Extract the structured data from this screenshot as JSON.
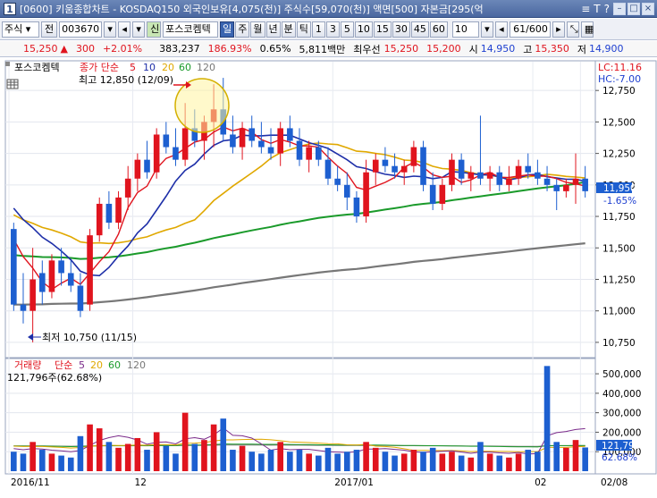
{
  "window": {
    "number": "1",
    "title": "[0600] 키움종합차트 - KOSDAQ150 외국인보유[4,075(천)] 주식수[59,070(천)] 액면[500] 자본금[295(억"
  },
  "titlebar_glyphs": [
    "≡",
    "T",
    "?"
  ],
  "toolbar": {
    "type_select": "주식",
    "prev_label": "전",
    "code": "003670",
    "stock_name": "포스코켐텍",
    "periods": [
      "일",
      "주",
      "월",
      "년",
      "분",
      "틱",
      "1",
      "3",
      "5",
      "10",
      "15",
      "30",
      "45",
      "60"
    ],
    "active_period": "일",
    "interval_value": "10",
    "count": "61/600"
  },
  "quote": {
    "price": "15,250",
    "change": "300",
    "change_rate": "+2.01%",
    "volume": "383,237",
    "volume_ratio": "186.93%",
    "turnover": "0.65%",
    "amount": "5,811백만",
    "best_label": "최우선",
    "ask": "15,250",
    "bid": "15,200",
    "open_label": "시",
    "open": "14,950",
    "high_label": "고",
    "high": "15,350",
    "low_label": "저",
    "low": "14,900"
  },
  "price_panel": {
    "stock_label": "포스코켐텍",
    "ma_title": "종가 단순",
    "ma_periods": [
      "5",
      "10",
      "20",
      "60",
      "120"
    ],
    "high_text": "최고 12,850 (12/09)",
    "low_text": "최저 10,750 (11/15)",
    "lc_label": "LC:11.16",
    "hc_label": "HC:-7.00",
    "current_price_tag": "11,950",
    "current_change_tag": "-1.65%",
    "y_ticks": [
      "12,750",
      "12,500",
      "12,250",
      "12,000",
      "11,750",
      "11,500",
      "11,250",
      "11,000",
      "10,750"
    ]
  },
  "volume_panel": {
    "title": "거래량",
    "ma_title": "단순",
    "ma_periods": [
      "5",
      "20",
      "60",
      "120"
    ],
    "value_text": "121,796주(62.68%)",
    "y_ticks": [
      "500,000",
      "400,000",
      "300,000",
      "200,000",
      "100,000"
    ],
    "current_tag": "121,796",
    "pct_tag": "62.68%"
  },
  "x_ticks": [
    "2016/11",
    "12",
    "2017/01",
    "02",
    "02/08"
  ],
  "colors": {
    "up": "#e0141e",
    "down": "#1d5fd0",
    "ma5": "#e0141e",
    "ma10": "#1e2fa8",
    "ma20": "#e0a800",
    "ma60": "#1a9a2a",
    "ma120": "#777777"
  },
  "chart_data": {
    "type": "candlestick",
    "series": [
      {
        "name": "5",
        "values": []
      },
      {
        "name": "10",
        "values": []
      },
      {
        "name": "20",
        "values": []
      },
      {
        "name": "60",
        "values": []
      },
      {
        "name": "120",
        "values": []
      }
    ],
    "candles": [
      {
        "o": 11650,
        "h": 11700,
        "l": 11000,
        "c": 11050,
        "v": 100000
      },
      {
        "o": 11050,
        "h": 11300,
        "l": 10900,
        "c": 11000,
        "v": 90000
      },
      {
        "o": 11000,
        "h": 11500,
        "l": 10750,
        "c": 11250,
        "v": 150000
      },
      {
        "o": 11300,
        "h": 11400,
        "l": 11050,
        "c": 11150,
        "v": 110000
      },
      {
        "o": 11150,
        "h": 11450,
        "l": 11100,
        "c": 11400,
        "v": 90000
      },
      {
        "o": 11400,
        "h": 11500,
        "l": 11200,
        "c": 11300,
        "v": 80000
      },
      {
        "o": 11300,
        "h": 11400,
        "l": 11150,
        "c": 11200,
        "v": 70000
      },
      {
        "o": 11200,
        "h": 11300,
        "l": 10950,
        "c": 11000,
        "v": 180000
      },
      {
        "o": 11050,
        "h": 11650,
        "l": 11000,
        "c": 11600,
        "v": 240000
      },
      {
        "o": 11600,
        "h": 11900,
        "l": 11550,
        "c": 11850,
        "v": 220000
      },
      {
        "o": 11850,
        "h": 11950,
        "l": 11650,
        "c": 11700,
        "v": 150000
      },
      {
        "o": 11700,
        "h": 11950,
        "l": 11650,
        "c": 11900,
        "v": 120000
      },
      {
        "o": 11900,
        "h": 12150,
        "l": 11800,
        "c": 12050,
        "v": 140000
      },
      {
        "o": 12050,
        "h": 12250,
        "l": 11950,
        "c": 12200,
        "v": 170000
      },
      {
        "o": 12200,
        "h": 12350,
        "l": 12050,
        "c": 12100,
        "v": 110000
      },
      {
        "o": 12100,
        "h": 12450,
        "l": 12050,
        "c": 12400,
        "v": 200000
      },
      {
        "o": 12400,
        "h": 12500,
        "l": 12250,
        "c": 12300,
        "v": 130000
      },
      {
        "o": 12300,
        "h": 12450,
        "l": 12150,
        "c": 12200,
        "v": 90000
      },
      {
        "o": 12200,
        "h": 12650,
        "l": 12150,
        "c": 12450,
        "v": 300000
      },
      {
        "o": 12450,
        "h": 12600,
        "l": 12300,
        "c": 12350,
        "v": 140000
      },
      {
        "o": 12350,
        "h": 12550,
        "l": 12200,
        "c": 12500,
        "v": 160000
      },
      {
        "o": 12500,
        "h": 12800,
        "l": 12300,
        "c": 12600,
        "v": 240000
      },
      {
        "o": 12600,
        "h": 12850,
        "l": 12350,
        "c": 12400,
        "v": 270000
      },
      {
        "o": 12400,
        "h": 12550,
        "l": 12250,
        "c": 12300,
        "v": 110000
      },
      {
        "o": 12300,
        "h": 12500,
        "l": 12200,
        "c": 12450,
        "v": 130000
      },
      {
        "o": 12450,
        "h": 12550,
        "l": 12300,
        "c": 12350,
        "v": 100000
      },
      {
        "o": 12350,
        "h": 12500,
        "l": 12250,
        "c": 12300,
        "v": 90000
      },
      {
        "o": 12300,
        "h": 12450,
        "l": 12200,
        "c": 12250,
        "v": 110000
      },
      {
        "o": 12250,
        "h": 12500,
        "l": 12150,
        "c": 12450,
        "v": 150000
      },
      {
        "o": 12450,
        "h": 12550,
        "l": 12300,
        "c": 12350,
        "v": 100000
      },
      {
        "o": 12350,
        "h": 12450,
        "l": 12150,
        "c": 12200,
        "v": 110000
      },
      {
        "o": 12200,
        "h": 12350,
        "l": 12100,
        "c": 12300,
        "v": 90000
      },
      {
        "o": 12300,
        "h": 12350,
        "l": 12150,
        "c": 12200,
        "v": 80000
      },
      {
        "o": 12200,
        "h": 12300,
        "l": 12000,
        "c": 12050,
        "v": 120000
      },
      {
        "o": 12050,
        "h": 12150,
        "l": 11950,
        "c": 12000,
        "v": 90000
      },
      {
        "o": 12000,
        "h": 12100,
        "l": 11800,
        "c": 11900,
        "v": 100000
      },
      {
        "o": 11900,
        "h": 11950,
        "l": 11700,
        "c": 11750,
        "v": 110000
      },
      {
        "o": 11750,
        "h": 12200,
        "l": 11700,
        "c": 12100,
        "v": 150000
      },
      {
        "o": 12100,
        "h": 12250,
        "l": 12000,
        "c": 12200,
        "v": 120000
      },
      {
        "o": 12200,
        "h": 12300,
        "l": 12100,
        "c": 12150,
        "v": 100000
      },
      {
        "o": 12150,
        "h": 12250,
        "l": 12050,
        "c": 12100,
        "v": 80000
      },
      {
        "o": 12100,
        "h": 12200,
        "l": 12000,
        "c": 12150,
        "v": 90000
      },
      {
        "o": 12150,
        "h": 12350,
        "l": 12100,
        "c": 12300,
        "v": 110000
      },
      {
        "o": 12300,
        "h": 12350,
        "l": 11950,
        "c": 12000,
        "v": 100000
      },
      {
        "o": 12000,
        "h": 12100,
        "l": 11800,
        "c": 11850,
        "v": 120000
      },
      {
        "o": 11850,
        "h": 12050,
        "l": 11800,
        "c": 12000,
        "v": 90000
      },
      {
        "o": 12000,
        "h": 12250,
        "l": 11950,
        "c": 12200,
        "v": 100000
      },
      {
        "o": 12200,
        "h": 12250,
        "l": 12000,
        "c": 12050,
        "v": 80000
      },
      {
        "o": 12050,
        "h": 12150,
        "l": 11950,
        "c": 12100,
        "v": 70000
      },
      {
        "o": 12100,
        "h": 12550,
        "l": 12000,
        "c": 12050,
        "v": 150000
      },
      {
        "o": 12050,
        "h": 12150,
        "l": 11950,
        "c": 12100,
        "v": 90000
      },
      {
        "o": 12100,
        "h": 12150,
        "l": 11950,
        "c": 12000,
        "v": 80000
      },
      {
        "o": 12000,
        "h": 12150,
        "l": 11950,
        "c": 12050,
        "v": 70000
      },
      {
        "o": 12050,
        "h": 12200,
        "l": 12000,
        "c": 12150,
        "v": 90000
      },
      {
        "o": 12150,
        "h": 12250,
        "l": 12050,
        "c": 12100,
        "v": 110000
      },
      {
        "o": 12100,
        "h": 12200,
        "l": 12000,
        "c": 12050,
        "v": 100000
      },
      {
        "o": 12050,
        "h": 12150,
        "l": 11950,
        "c": 12000,
        "v": 540000
      },
      {
        "o": 12000,
        "h": 12050,
        "l": 11800,
        "c": 11950,
        "v": 150000
      },
      {
        "o": 11950,
        "h": 12050,
        "l": 11900,
        "c": 12000,
        "v": 120000
      },
      {
        "o": 12000,
        "h": 12250,
        "l": 11850,
        "c": 12050,
        "v": 160000
      },
      {
        "o": 12050,
        "h": 12150,
        "l": 11900,
        "c": 11950,
        "v": 121796
      }
    ],
    "y_range": [
      10650,
      12950
    ],
    "volume_range": [
      0,
      560000
    ]
  }
}
